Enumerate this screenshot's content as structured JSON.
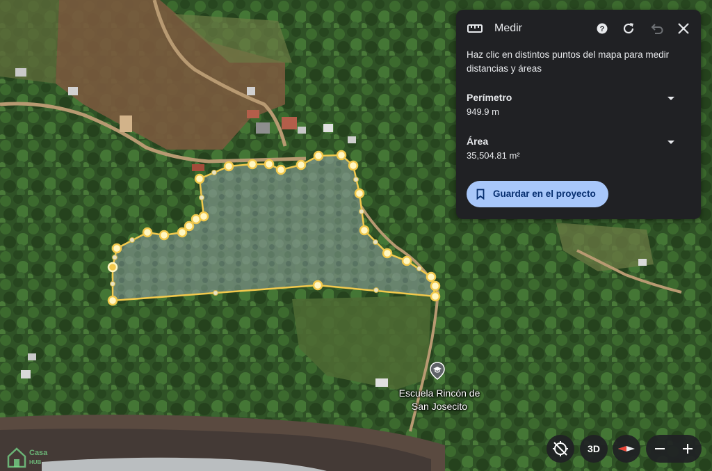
{
  "measure_panel": {
    "title": "Medir",
    "instructions": "Haz clic en distintos puntos del mapa para medir distancias y áreas",
    "perimeter_label": "Perímetro",
    "perimeter_value": "949.9 m",
    "area_label": "Área",
    "area_value": "35,504.81 m²",
    "save_button": "Guardar en el proyecto",
    "accent_color": "#a8c7fa",
    "panel_color": "#202124"
  },
  "map": {
    "place_label": "Escuela Rincón de San Josecito",
    "place_icon": "school-pin-icon",
    "measure_line_color": "#f2c94c"
  },
  "controls": {
    "btn_3d": "3D",
    "compass_icon": "compass-icon",
    "zoom_out_icon": "minus-icon",
    "zoom_in_icon": "plus-icon"
  },
  "watermark": {
    "text": "Casa",
    "sub": "HUB"
  }
}
